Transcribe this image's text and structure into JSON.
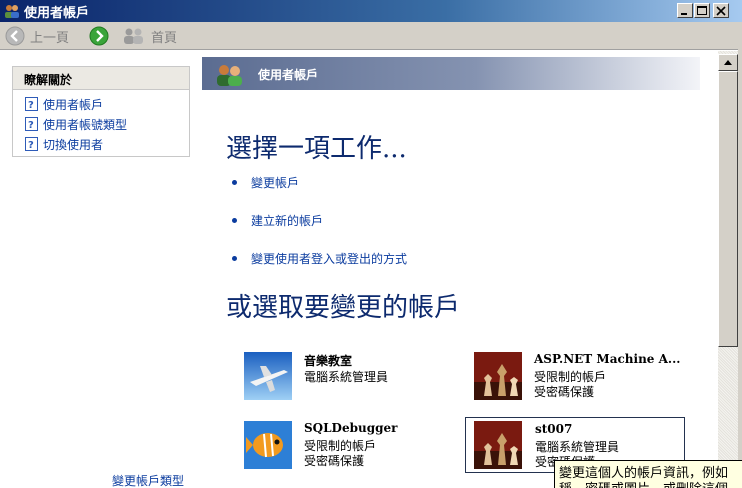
{
  "window": {
    "title": "使用者帳戶"
  },
  "toolbar": {
    "back_label": "上一頁",
    "home_label": "首頁"
  },
  "learn_about": {
    "title": "瞭解關於",
    "items": [
      "使用者帳戶",
      "使用者帳號類型",
      "切換使用者"
    ],
    "overflow_text": "變更帳戶類型"
  },
  "banner": {
    "title": "使用者帳戶"
  },
  "main": {
    "pick_task_heading": "選擇一項工作...",
    "tasks": [
      "變更帳戶",
      "建立新的帳戶",
      "變更使用者登入或登出的方式"
    ],
    "pick_account_heading": "或選取要變更的帳戶"
  },
  "accounts": [
    {
      "name": "音樂教室",
      "line1": "電腦系統管理員",
      "line2": "",
      "picture": "airplane"
    },
    {
      "name": "ASP.NET Machine A...",
      "line1": "受限制的帳戶",
      "line2": "受密碼保護",
      "picture": "chess"
    },
    {
      "name": "SQLDebugger",
      "line1": "受限制的帳戶",
      "line2": "受密碼保護",
      "picture": "fish"
    },
    {
      "name": "st007",
      "line1": "電腦系統管理員",
      "line2": "受密碼保護",
      "picture": "chess"
    }
  ],
  "tooltip": {
    "line1": "變更這個人的帳戶資訊，例如",
    "line2": "稱、密碼或圖片，或刪除這個"
  },
  "colors": {
    "link": "#0b3c9f",
    "heading": "#0d2a6e",
    "banner_start": "#5b6c91",
    "title_bar": "#0a246a"
  }
}
